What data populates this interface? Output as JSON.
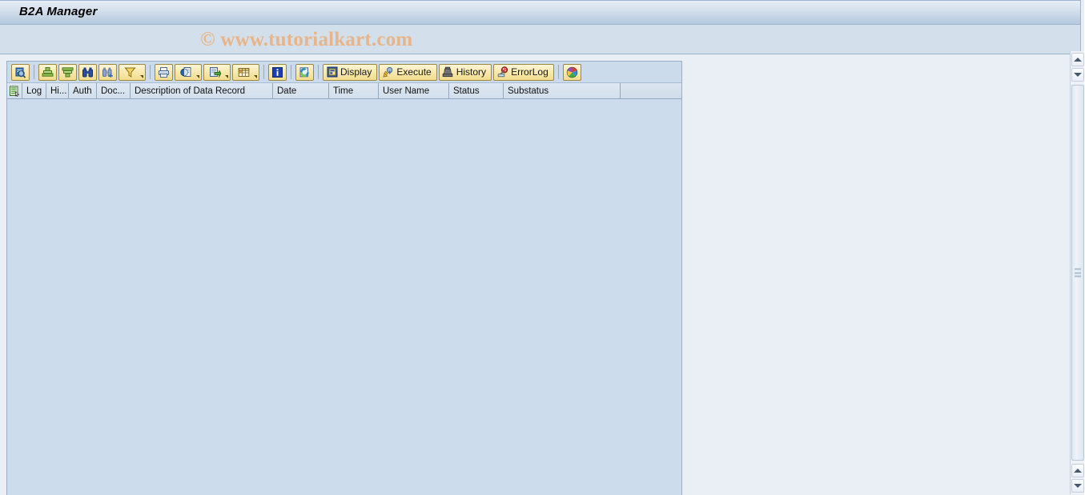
{
  "window": {
    "title": "B2A Manager"
  },
  "watermark": {
    "text": "© www.tutorialkart.com"
  },
  "colors": {
    "title_bar_top": "#e7eef6",
    "title_bar_bottom": "#b5c8dd",
    "subheader_bg": "#d3dfeb",
    "workarea_bg": "#eaeff6",
    "grid_bg": "#cddced",
    "toolbar_bg": "#ccdbec",
    "button_face": "#f7e7a8",
    "button_border": "#a0883f",
    "watermark_color": "#e8b588",
    "column_header_bg": "#d2dfec"
  },
  "toolbar": {
    "icon_buttons": [
      {
        "name": "display-details-icon",
        "tooltip": "Display"
      },
      {
        "name": "sort-ascending-icon",
        "tooltip": "Sort in Ascending Order"
      },
      {
        "name": "sort-descending-icon",
        "tooltip": "Sort in Descending Order"
      },
      {
        "name": "find-icon",
        "tooltip": "Find"
      },
      {
        "name": "find-next-icon",
        "tooltip": "Find Next"
      },
      {
        "name": "filter-icon",
        "tooltip": "Set Filter",
        "has_dropdown": true
      },
      {
        "name": "print-icon",
        "tooltip": "Print"
      },
      {
        "name": "print-preview-icon",
        "tooltip": "Print Preview",
        "has_dropdown": true
      },
      {
        "name": "export-icon",
        "tooltip": "Export",
        "has_dropdown": true
      },
      {
        "name": "spreadsheet-icon",
        "tooltip": "Spreadsheet",
        "has_dropdown": true
      },
      {
        "name": "info-icon",
        "tooltip": "Information"
      },
      {
        "name": "refresh-icon",
        "tooltip": "Refresh"
      }
    ],
    "labeled_buttons": [
      {
        "label": "Display",
        "icon": "display-icon"
      },
      {
        "label": "Execute",
        "icon": "execute-icon"
      },
      {
        "label": "History",
        "icon": "history-icon"
      },
      {
        "label": "ErrorLog",
        "icon": "errorlog-icon"
      }
    ],
    "palette_button": {
      "name": "color-palette-icon",
      "tooltip": "Choose Color"
    }
  },
  "grid": {
    "select_all_icon": "select-all-icon",
    "columns": [
      {
        "label": "Log",
        "width": 30
      },
      {
        "label": "Hi...",
        "width": 28
      },
      {
        "label": "Auth",
        "width": 35
      },
      {
        "label": "Doc...",
        "width": 42
      },
      {
        "label": "Description of Data Record",
        "width": 178
      },
      {
        "label": "Date",
        "width": 70
      },
      {
        "label": "Time",
        "width": 62
      },
      {
        "label": "User Name",
        "width": 88
      },
      {
        "label": "Status",
        "width": 68
      },
      {
        "label": "Substatus",
        "width": 146
      }
    ],
    "rows": []
  },
  "scrollbar": {
    "orientation": "vertical",
    "up_arrow": "scroll-up-arrow",
    "down_arrow": "scroll-down-arrow"
  }
}
